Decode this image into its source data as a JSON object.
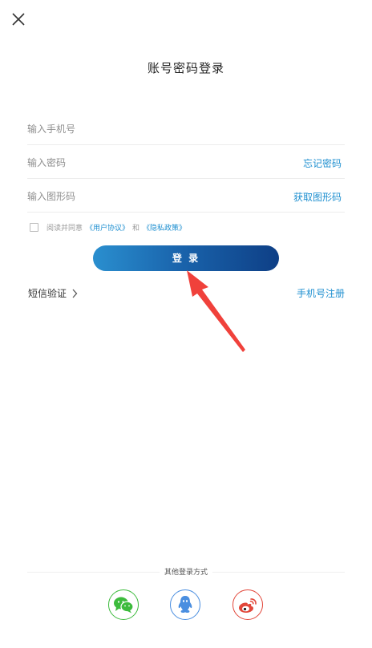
{
  "header": {
    "close_icon": "close-icon",
    "title": "账号密码登录"
  },
  "form": {
    "phone_placeholder": "输入手机号",
    "password_placeholder": "输入密码",
    "forgot_password": "忘记密码",
    "captcha_placeholder": "输入图形码",
    "get_captcha": "获取图形码"
  },
  "agreement": {
    "prefix": "阅读并同意",
    "user_agreement": "《用户协议》",
    "and": "和",
    "privacy_policy": "《隐私政策》",
    "checked": false
  },
  "login_button": {
    "label": "登 录"
  },
  "links": {
    "sms_login": "短信验证",
    "phone_register": "手机号注册"
  },
  "other_login": {
    "label": "其他登录方式",
    "providers": [
      {
        "name": "wechat",
        "icon": "wechat-icon",
        "color": "#3dbb3d"
      },
      {
        "name": "qq",
        "icon": "qq-icon",
        "color": "#4a8ee0"
      },
      {
        "name": "weibo",
        "icon": "weibo-icon",
        "color": "#e2473a"
      }
    ]
  },
  "colors": {
    "accent": "#1e8fd0",
    "button_gradient_start": "#2a8fcf",
    "button_gradient_end": "#0e3f86",
    "annotation_arrow": "#f0413b"
  }
}
